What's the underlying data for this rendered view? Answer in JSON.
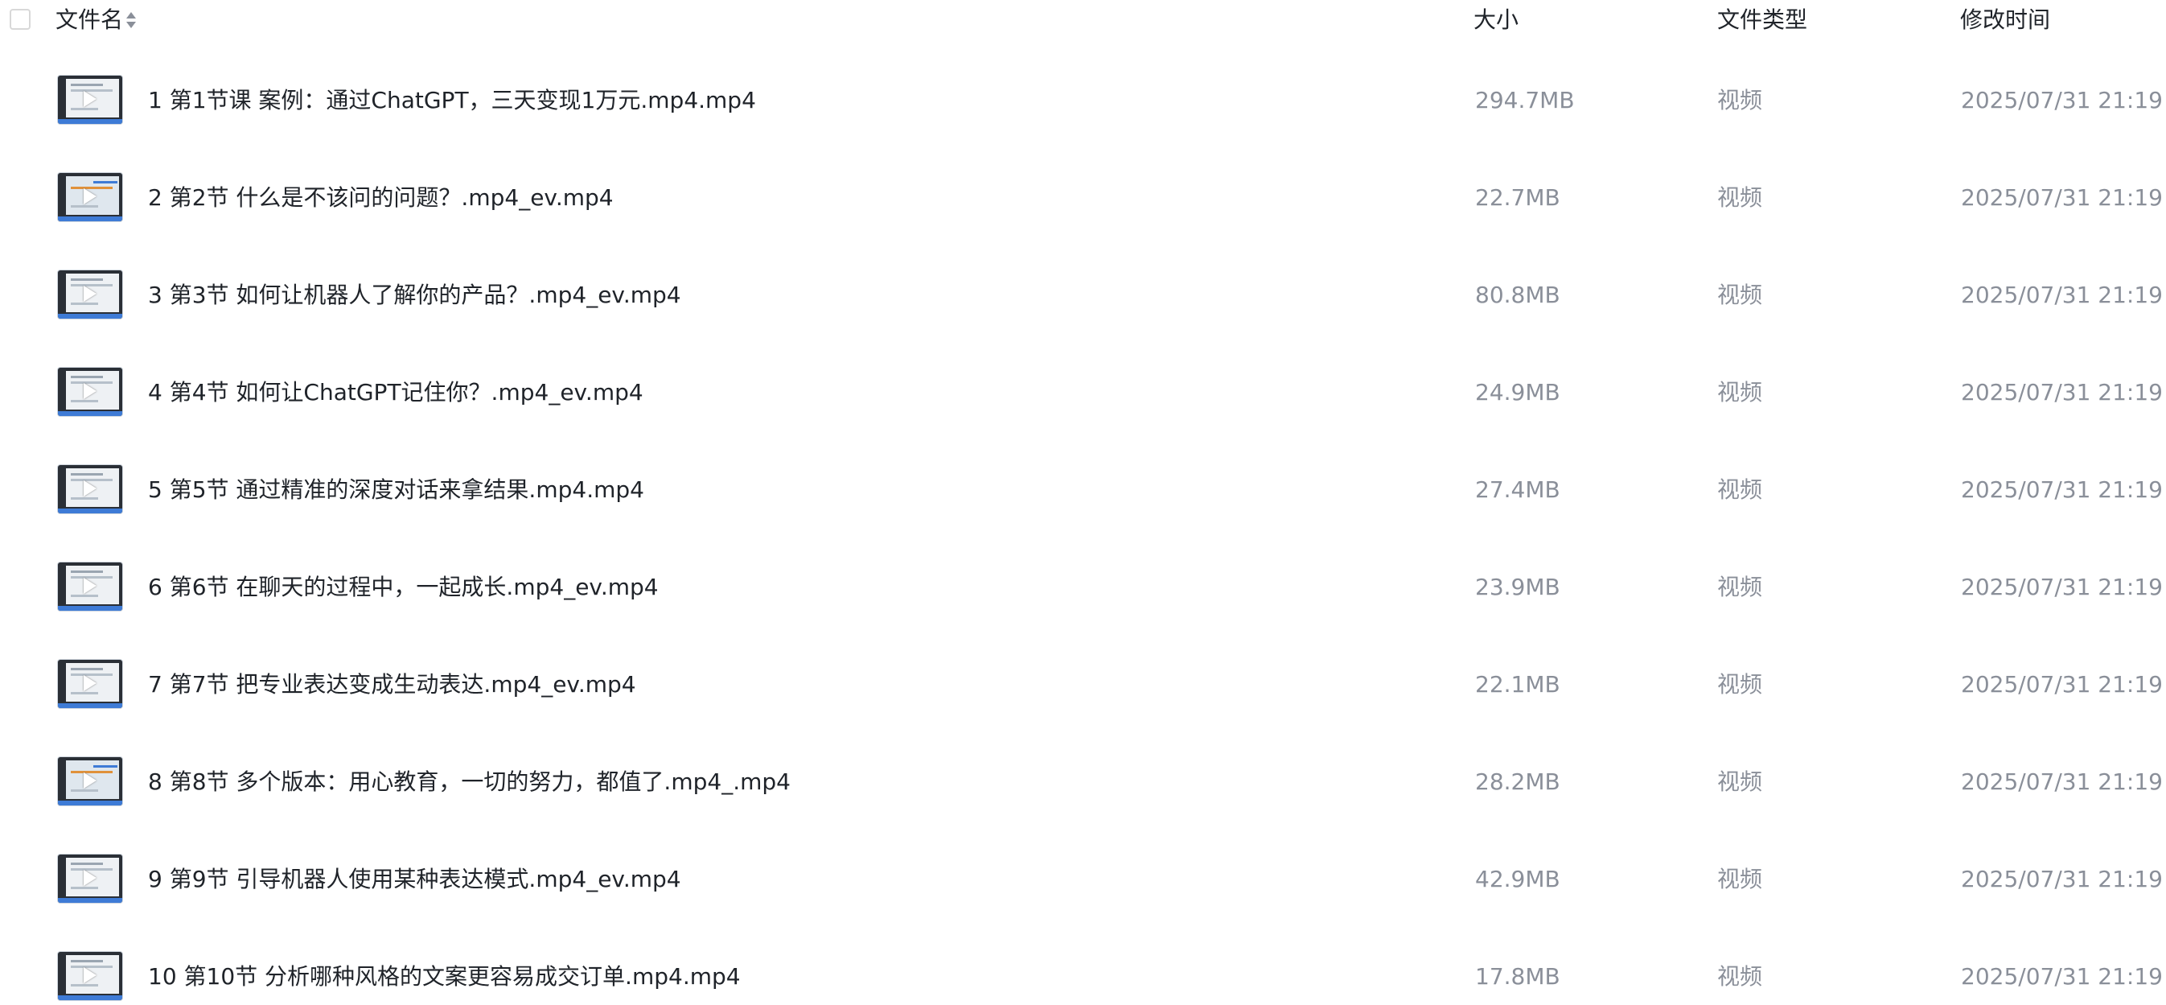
{
  "header": {
    "name_label": "文件名",
    "size_label": "大小",
    "type_label": "文件类型",
    "time_label": "修改时间"
  },
  "files": [
    {
      "name": "1 第1节课  案例：通过ChatGPT，三天变现1万元.mp4.mp4",
      "size": "294.7MB",
      "type": "视频",
      "time": "2025/07/31 21:19"
    },
    {
      "name": "2 第2节  什么是不该问的问题？.mp4_ev.mp4",
      "size": "22.7MB",
      "type": "视频",
      "time": "2025/07/31 21:19"
    },
    {
      "name": "3 第3节  如何让机器人了解你的产品？.mp4_ev.mp4",
      "size": "80.8MB",
      "type": "视频",
      "time": "2025/07/31 21:19"
    },
    {
      "name": "4 第4节  如何让ChatGPT记住你？.mp4_ev.mp4",
      "size": "24.9MB",
      "type": "视频",
      "time": "2025/07/31 21:19"
    },
    {
      "name": "5 第5节  通过精准的深度对话来拿结果.mp4.mp4",
      "size": "27.4MB",
      "type": "视频",
      "time": "2025/07/31 21:19"
    },
    {
      "name": "6 第6节  在聊天的过程中，一起成长.mp4_ev.mp4",
      "size": "23.9MB",
      "type": "视频",
      "time": "2025/07/31 21:19"
    },
    {
      "name": "7 第7节 把专业表达变成生动表达.mp4_ev.mp4",
      "size": "22.1MB",
      "type": "视频",
      "time": "2025/07/31 21:19"
    },
    {
      "name": "8 第8节 多个版本：用心教育，一切的努力，都值了.mp4_.mp4",
      "size": "28.2MB",
      "type": "视频",
      "time": "2025/07/31 21:19"
    },
    {
      "name": "9 第9节 引导机器人使用某种表达模式.mp4_ev.mp4",
      "size": "42.9MB",
      "type": "视频",
      "time": "2025/07/31 21:19"
    },
    {
      "name": "10 第10节  分析哪种风格的文案更容易成交订单.mp4.mp4",
      "size": "17.8MB",
      "type": "视频",
      "time": "2025/07/31 21:19"
    }
  ]
}
